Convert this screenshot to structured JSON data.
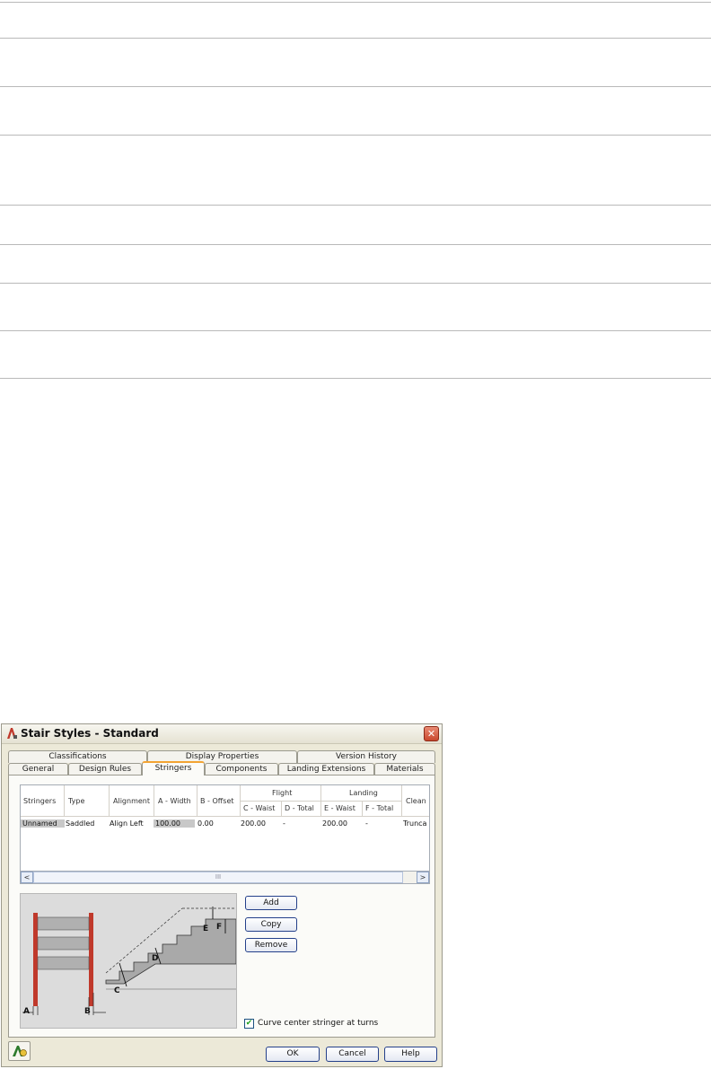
{
  "dialog": {
    "title": "Stair Styles - Standard",
    "close_symbol": "✕",
    "tabs_back": [
      "Classifications",
      "Display Properties",
      "Version History"
    ],
    "tabs_front": [
      "General",
      "Design Rules",
      "Stringers",
      "Components",
      "Landing Extensions",
      "Materials"
    ],
    "active_tab": "Stringers",
    "grid": {
      "headers": {
        "stringers": "Stringers",
        "type": "Type",
        "alignment": "Alignment",
        "a_width": "A - Width",
        "b_offset": "B - Offset",
        "flight": "Flight",
        "landing": "Landing",
        "c_waist": "C - Waist",
        "d_total": "D - Total",
        "e_waist": "E - Waist",
        "f_total": "F - Total",
        "clean": "Clean"
      },
      "row": {
        "stringers": "Unnamed",
        "type": "Saddled",
        "alignment": "Align Left",
        "a_width": "100.00",
        "b_offset": "0.00",
        "c_waist": "200.00",
        "d_total": "-",
        "e_waist": "200.00",
        "f_total": "-",
        "clean": "Trunca"
      }
    },
    "scroll": {
      "left": "<",
      "right": ">",
      "grip": "III"
    },
    "buttons": {
      "add": "Add",
      "copy": "Copy",
      "remove": "Remove"
    },
    "illustration_labels": {
      "a": "A",
      "b": "B",
      "c": "C",
      "d": "D",
      "e": "E",
      "f": "F"
    },
    "checkbox": {
      "label": "Curve center stringer at turns",
      "checked": true,
      "mark": "✔"
    },
    "footer": {
      "ok": "OK",
      "cancel": "Cancel",
      "help": "Help"
    },
    "colors": {
      "active_tab_accent": "#f3a432",
      "button_border": "#24408a",
      "stringer_red": "#c0392b"
    }
  }
}
